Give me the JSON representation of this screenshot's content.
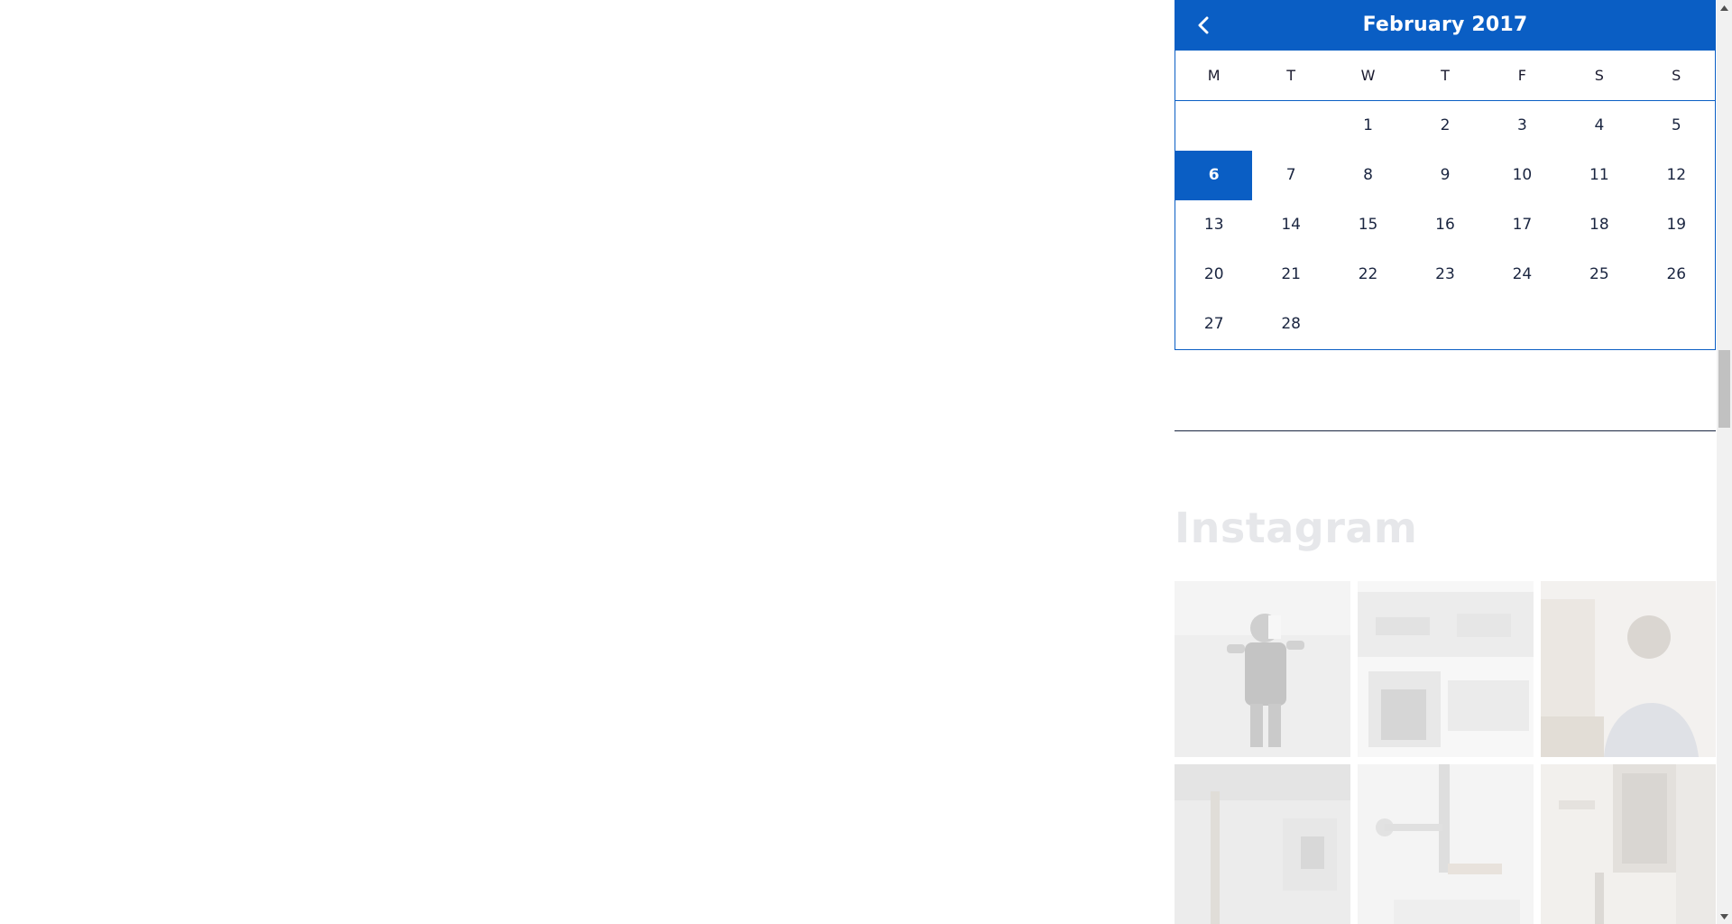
{
  "calendar": {
    "title": "February 2017",
    "prev_icon": "chevron-left-icon",
    "weekdays": [
      "M",
      "T",
      "W",
      "T",
      "F",
      "S",
      "S"
    ],
    "leading_blanks": 2,
    "days": [
      "1",
      "2",
      "3",
      "4",
      "5",
      "6",
      "7",
      "8",
      "9",
      "10",
      "11",
      "12",
      "13",
      "14",
      "15",
      "16",
      "17",
      "18",
      "19",
      "20",
      "21",
      "22",
      "23",
      "24",
      "25",
      "26",
      "27",
      "28"
    ],
    "today": "6"
  },
  "instagram": {
    "title": "Instagram",
    "tiles": [
      {
        "desc": "instagram-photo"
      },
      {
        "desc": "instagram-photo"
      },
      {
        "desc": "instagram-photo"
      },
      {
        "desc": "instagram-photo"
      },
      {
        "desc": "instagram-photo"
      },
      {
        "desc": "instagram-photo"
      }
    ]
  },
  "colors": {
    "accent": "#0a5ec4",
    "text": "#1a2540",
    "muted_title": "#e6e7ea"
  }
}
